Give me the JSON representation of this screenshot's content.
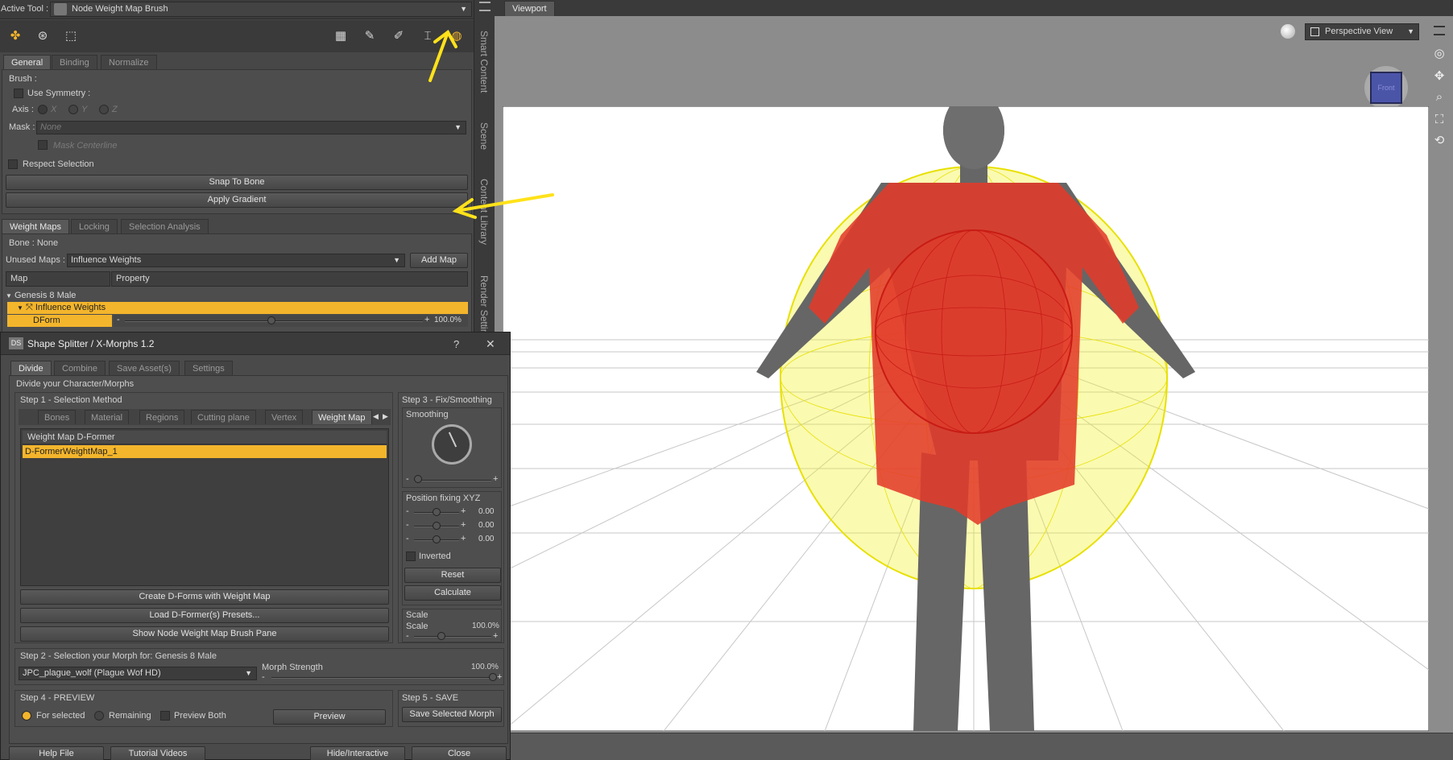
{
  "active_tool": {
    "label": "Active Tool :",
    "value": "Node Weight Map Brush"
  },
  "panel_tabs": [
    "General",
    "Binding",
    "Normalize"
  ],
  "brush": {
    "heading": "Brush :",
    "use_symmetry": "Use Symmetry :",
    "axis_label": "Axis :",
    "axis_options": [
      "X",
      "Y",
      "Z"
    ],
    "mask_label": "Mask :",
    "mask_value": "None",
    "mask_centerline": "Mask Centerline",
    "respect_selection": "Respect Selection",
    "snap_to_bone": "Snap To Bone",
    "apply_gradient": "Apply Gradient"
  },
  "weight_tabs": [
    "Weight Maps",
    "Locking",
    "Selection Analysis"
  ],
  "weight_maps": {
    "bone_label": "Bone : None",
    "unused_maps_label": "Unused Maps :",
    "unused_maps_value": "Influence Weights",
    "add_map": "Add Map",
    "col_map": "Map",
    "col_property": "Property",
    "tree_root": "Genesis 8 Male",
    "tree_child": "Influence Weights",
    "dform_label": "DForm",
    "dform_value": "100.0%"
  },
  "side_tabs": [
    "Smart Content",
    "Scene",
    "Content Library",
    "Render Settings"
  ],
  "dialog": {
    "title": "Shape Splitter / X-Morphs 1.2",
    "help": "?",
    "close": "✕",
    "tabs": [
      "Divide",
      "Combine",
      "Save Asset(s)",
      "Settings"
    ],
    "subtitle": "Divide your Character/Morphs",
    "step1": "Step 1 - Selection Method",
    "method_tabs": [
      "Bones",
      "Material",
      "Regions",
      "Cutting plane",
      "Vertex",
      "Weight Map"
    ],
    "list_header": "Weight Map D-Former",
    "list_item": "D-FormerWeightMap_1",
    "create_btn": "Create D-Forms with Weight Map",
    "load_btn": "Load D-Former(s) Presets...",
    "show_btn": "Show Node Weight Map Brush Pane",
    "step3": "Step 3 - Fix/Smoothing",
    "smoothing": "Smoothing",
    "position_fixing": "Position fixing XYZ",
    "pos_values": [
      "0.00",
      "0.00",
      "0.00"
    ],
    "inverted": "Inverted",
    "reset": "Reset",
    "calculate": "Calculate",
    "scale_heading": "Scale",
    "scale_label": "Scale",
    "scale_value": "100.0%",
    "step2": "Step 2 - Selection your Morph for: Genesis 8 Male",
    "morph_value": "JPC_plague_wolf (Plague Wof HD)",
    "morph_strength": "Morph Strength",
    "morph_strength_value": "100.0%",
    "step4": "Step 4 - PREVIEW",
    "for_selected": "For selected",
    "remaining": "Remaining",
    "preview_both": "Preview Both",
    "preview": "Preview",
    "step5": "Step 5 - SAVE",
    "save_selected": "Save Selected Morph",
    "footer": [
      "Help File",
      "Tutorial Videos",
      "Hide/Interactive",
      "Close"
    ]
  },
  "viewport": {
    "tab": "Viewport",
    "view": "Perspective View",
    "cube_label": "Front"
  },
  "colors": {
    "accent": "#f3b52c",
    "annotation": "#ffe21a",
    "weight_red": "#e23b2a",
    "influence_yellow": "#f2f020"
  }
}
